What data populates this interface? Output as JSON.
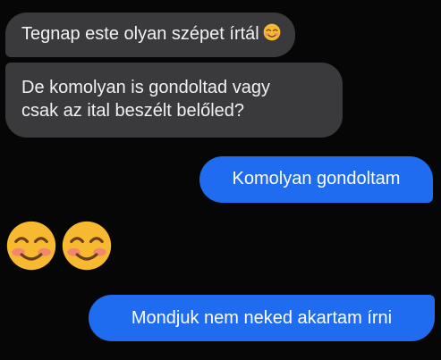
{
  "messages": [
    {
      "from": "received",
      "text": "Tegnap este olyan szépet írtál",
      "emoji": "smiling-face-with-smiling-eyes"
    },
    {
      "from": "received",
      "lines": [
        "De komolyan is gondoltad vagy",
        "csak az ital beszélt belőled?"
      ]
    },
    {
      "from": "sent",
      "text": "Komolyan gondoltam"
    },
    {
      "from": "received",
      "emojis": [
        "smiling-face-with-smiling-eyes",
        "smiling-face-with-smiling-eyes"
      ]
    },
    {
      "from": "sent",
      "text": "Mondjuk nem neked akartam írni"
    }
  ],
  "colors": {
    "background": "#060606",
    "received_bubble": "#3a3a3c",
    "sent_bubble": "#1f6cf0",
    "emoji_face": "#f7b930",
    "blush": "#f3876e"
  }
}
